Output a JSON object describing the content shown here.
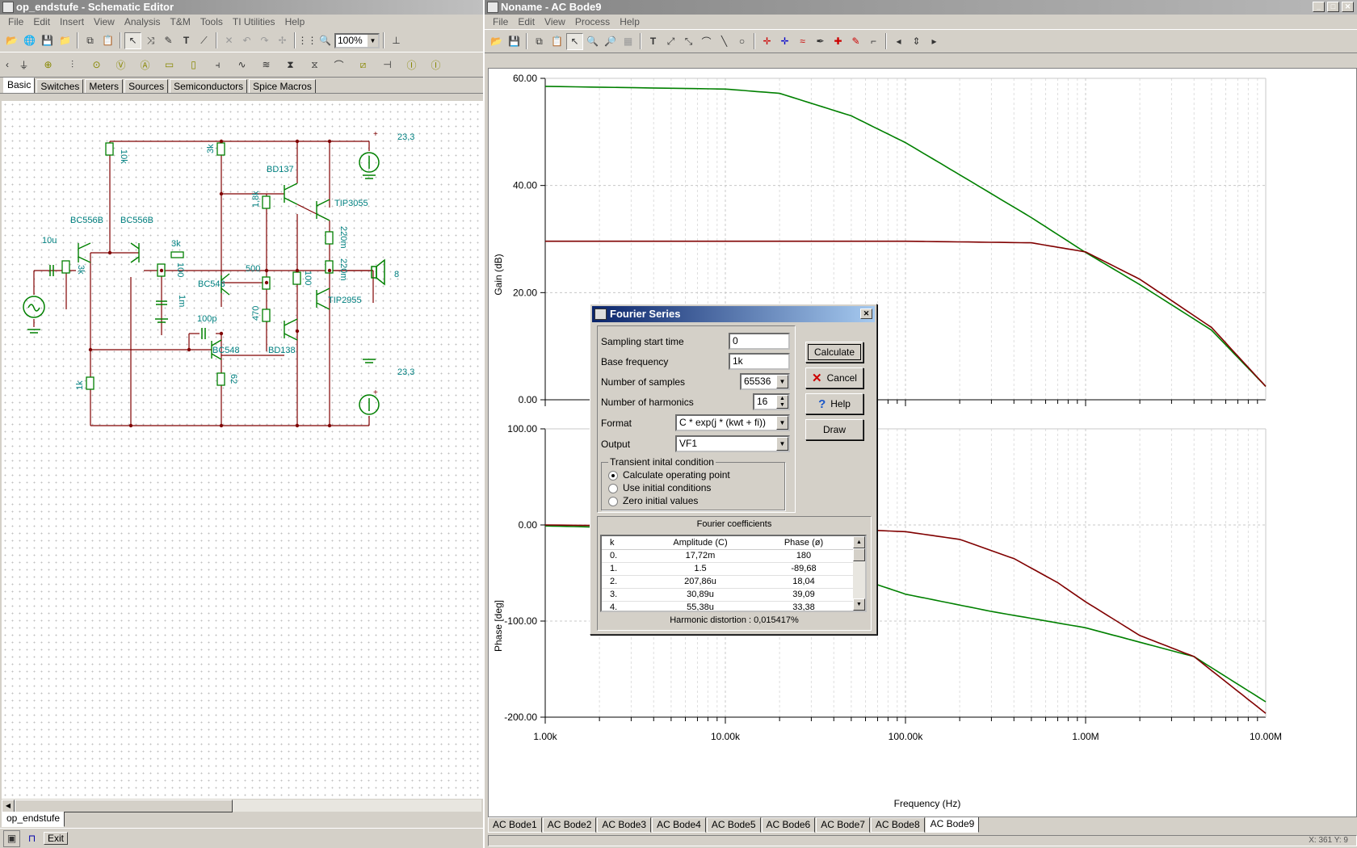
{
  "schematic": {
    "title": "op_endstufe - Schematic Editor",
    "menu": [
      "File",
      "Edit",
      "Insert",
      "View",
      "Analysis",
      "T&M",
      "Tools",
      "TI Utilities",
      "Help"
    ],
    "zoom": "100%",
    "tabs": [
      "Basic",
      "Switches",
      "Meters",
      "Sources",
      "Semiconductors",
      "Spice Macros"
    ],
    "doc_tab": "op_endstufe",
    "bottom_exit": "Exit",
    "labels": {
      "r10k": "10k",
      "r3k_top": "3k",
      "bd137": "BD137",
      "tip3055": "TIP3055",
      "r1_8k": "1,8k",
      "bc556b_1": "BC556B",
      "bc556b_2": "BC556B",
      "c10u": "10u",
      "r3k_in": "3k",
      "r3k_mid": "3k",
      "r100": "100",
      "c1m": "1m",
      "r500": "500",
      "bc548_1": "BC548",
      "r100b": "100",
      "r220m_1": "220m",
      "r220m_2": "220m",
      "tip2955": "TIP2955",
      "c100p": "100p",
      "r470": "470",
      "bd138": "BD138",
      "bc548_2": "BC548",
      "r62": "62",
      "r1k": "1k",
      "v_top": "23,3",
      "v_bot": "23,3",
      "spk": "8"
    }
  },
  "bode": {
    "title": "Noname - AC Bode9",
    "menu": [
      "File",
      "Edit",
      "View",
      "Process",
      "Help"
    ],
    "gain_ylabel": "Gain (dB)",
    "phase_ylabel": "Phase [deg]",
    "xlabel": "Frequency (Hz)",
    "gain_ticks": [
      "60.00",
      "40.00",
      "20.00",
      "0.00"
    ],
    "phase_ticks": [
      "100.00",
      "0.00",
      "-100.00",
      "-200.00"
    ],
    "x_ticks": [
      "1.00k",
      "10.00k",
      "100.00k",
      "1.00M",
      "10.00M"
    ],
    "tabs": [
      "AC Bode1",
      "AC Bode2",
      "AC Bode3",
      "AC Bode4",
      "AC Bode5",
      "AC Bode6",
      "AC Bode7",
      "AC Bode8",
      "AC Bode9"
    ],
    "status": "X: 361  Y: 9",
    "colors": {
      "green": "#008000",
      "red": "#800000"
    }
  },
  "chart_data": [
    {
      "type": "line",
      "xlabel": "Frequency (Hz)",
      "ylabel": "Gain (dB)",
      "x_scale": "log",
      "xlim": [
        1000,
        10000000
      ],
      "ylim": [
        0,
        60
      ],
      "grid": true,
      "series": [
        {
          "color": "green",
          "x": [
            1000,
            10000,
            20000,
            50000,
            100000,
            200000,
            500000,
            1000000,
            2000000,
            5000000,
            10000000
          ],
          "values": [
            58.5,
            58,
            57.2,
            53,
            48,
            42,
            34,
            27.5,
            21.5,
            13,
            2.5
          ]
        },
        {
          "color": "red",
          "x": [
            1000,
            10000,
            100000,
            500000,
            1000000,
            2000000,
            5000000,
            10000000
          ],
          "values": [
            29.6,
            29.6,
            29.6,
            29.3,
            27.6,
            22.5,
            13.5,
            2.5
          ]
        }
      ]
    },
    {
      "type": "line",
      "xlabel": "Frequency (Hz)",
      "ylabel": "Phase [deg]",
      "x_scale": "log",
      "xlim": [
        1000,
        10000000
      ],
      "ylim": [
        -200,
        100
      ],
      "grid": true,
      "series": [
        {
          "color": "green",
          "x": [
            1000,
            3000,
            10000,
            30000,
            60000,
            100000,
            300000,
            1000000,
            2000000,
            4000000,
            10000000
          ],
          "values": [
            -1,
            -3,
            -8,
            -30,
            -58,
            -72,
            -90,
            -107,
            -122,
            -137,
            -184
          ]
        },
        {
          "color": "red",
          "x": [
            1000,
            10000,
            30000,
            100000,
            200000,
            400000,
            700000,
            1000000,
            2000000,
            4000000,
            10000000
          ],
          "values": [
            0,
            -2,
            -3,
            -7,
            -15,
            -35,
            -60,
            -80,
            -115,
            -137,
            -196
          ]
        }
      ]
    }
  ],
  "dialog": {
    "title": "Fourier Series",
    "sampling_start_label": "Sampling start time",
    "sampling_start_value": "0",
    "base_freq_label": "Base frequency",
    "base_freq_value": "1k",
    "samples_label": "Number of samples",
    "samples_value": "65536",
    "harmonics_label": "Number of harmonics",
    "harmonics_value": "16",
    "format_label": "Format",
    "format_value": "C * exp(j * (kwt + fi))",
    "output_label": "Output",
    "output_value": "VF1",
    "transient_group": "Transient inital condition",
    "radio_calc": "Calculate operating point",
    "radio_use": "Use initial conditions",
    "radio_zero": "Zero initial values",
    "btn_calculate": "Calculate",
    "btn_cancel": "Cancel",
    "btn_help": "Help",
    "btn_draw": "Draw",
    "coeff_title": "Fourier coefficients",
    "col_k": "k",
    "col_amp": "Amplitude (C)",
    "col_phase": "Phase (ø)",
    "rows": [
      {
        "k": "0.",
        "amp": "17,72m",
        "phase": "180"
      },
      {
        "k": "1.",
        "amp": "1.5",
        "phase": "-89,68"
      },
      {
        "k": "2.",
        "amp": "207,86u",
        "phase": "18,04"
      },
      {
        "k": "3.",
        "amp": "30,89u",
        "phase": "39,09"
      },
      {
        "k": "4.",
        "amp": "55,38u",
        "phase": "33,38"
      }
    ],
    "thd_label": "Harmonic distortion :",
    "thd_value": "0,015417%"
  }
}
